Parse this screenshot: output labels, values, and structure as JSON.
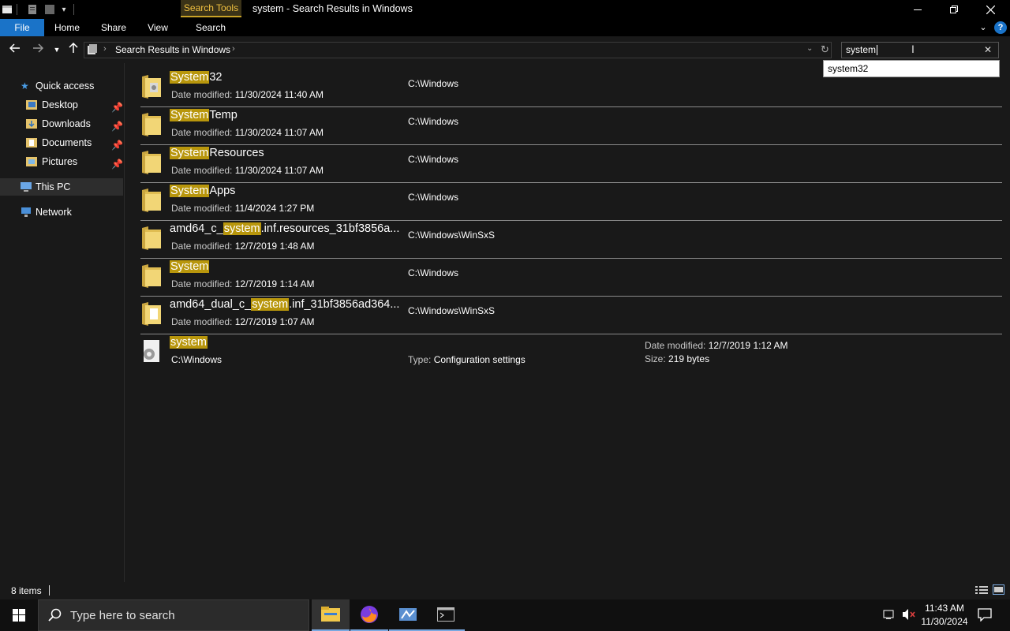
{
  "window": {
    "title": "system - Search Results in Windows",
    "contextual_tab": "Search Tools"
  },
  "ribbon": {
    "tabs": [
      "File",
      "Home",
      "Share",
      "View",
      "Search"
    ]
  },
  "address": {
    "path": "Search Results in Windows",
    "search_value": "system",
    "suggestion": "system32"
  },
  "sidebar": {
    "quick_access": "Quick access",
    "items": [
      "Desktop",
      "Downloads",
      "Documents",
      "Pictures"
    ],
    "this_pc": "This PC",
    "network": "Network"
  },
  "results": [
    {
      "pre": "",
      "hl": "System",
      "post": "32",
      "meta_label": "Date modified:",
      "meta": "11/30/2024 11:40 AM",
      "location": "C:\\Windows"
    },
    {
      "pre": "",
      "hl": "System",
      "post": "Temp",
      "meta_label": "Date modified:",
      "meta": "11/30/2024 11:07 AM",
      "location": "C:\\Windows"
    },
    {
      "pre": "",
      "hl": "System",
      "post": "Resources",
      "meta_label": "Date modified:",
      "meta": "11/30/2024 11:07 AM",
      "location": "C:\\Windows"
    },
    {
      "pre": "",
      "hl": "System",
      "post": "Apps",
      "meta_label": "Date modified:",
      "meta": "11/4/2024 1:27 PM",
      "location": "C:\\Windows"
    },
    {
      "pre": "amd64_c_",
      "hl": "system",
      "post": ".inf.resources_31bf3856a...",
      "meta_label": "Date modified:",
      "meta": "12/7/2019 1:48 AM",
      "location": "C:\\Windows\\WinSxS"
    },
    {
      "pre": "",
      "hl": "System",
      "post": "",
      "meta_label": "Date modified:",
      "meta": "12/7/2019 1:14 AM",
      "location": "C:\\Windows"
    },
    {
      "pre": "amd64_dual_c_",
      "hl": "system",
      "post": ".inf_31bf3856ad364...",
      "meta_label": "Date modified:",
      "meta": "12/7/2019 1:07 AM",
      "location": "C:\\Windows\\WinSxS"
    }
  ],
  "file_result": {
    "hl": "system",
    "path": "C:\\Windows",
    "type_label": "Type:",
    "type": "Configuration settings",
    "date_label": "Date modified:",
    "date": "12/7/2019 1:12 AM",
    "size_label": "Size:",
    "size": "219 bytes"
  },
  "status": {
    "items": "8 items"
  },
  "taskbar": {
    "search_placeholder": "Type here to search",
    "time": "11:43 AM",
    "date": "11/30/2024"
  },
  "colors": {
    "highlight": "#b8960c",
    "file_tab": "#1a73c8",
    "background": "#191919"
  }
}
